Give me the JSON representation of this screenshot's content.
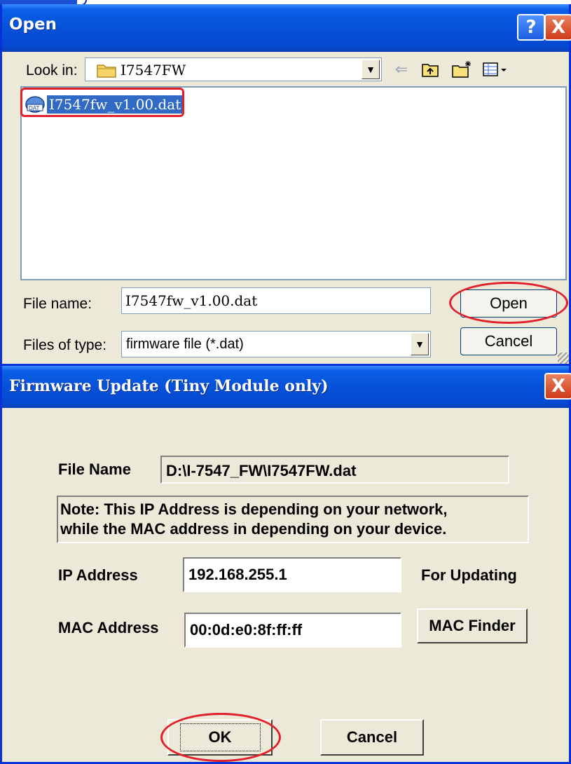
{
  "open_dialog": {
    "title": "Open",
    "help_button": "?",
    "close_button": "X",
    "look_in_label": "Look in:",
    "look_in_value": "I7547FW",
    "files": [
      {
        "name": "I7547fw_v1.00.dat",
        "icon": "dat-file-icon",
        "selected": true
      }
    ],
    "file_name_label": "File name:",
    "file_name_value": "I7547fw_v1.00.dat",
    "files_of_type_label": "Files of type:",
    "files_of_type_value": "firmware file (*.dat)",
    "open_button": "Open",
    "cancel_button": "Cancel",
    "toolbar_icons": [
      "back-arrow-icon",
      "up-folder-icon",
      "new-folder-icon",
      "view-menu-icon"
    ]
  },
  "firmware_dialog": {
    "title": "Firmware Update (Tiny Module only)",
    "close_button": "X",
    "file_name_label": "File Name",
    "file_name_value": "D:\\I-7547_FW\\I7547FW.dat",
    "note_line1": "Note: This IP Address is depending on your network,",
    "note_line2": "while the  MAC address in depending on your device.",
    "ip_label": "IP Address",
    "ip_value": "192.168.255.1",
    "ip_suffix": "For Updating",
    "mac_label": "MAC Address",
    "mac_value": "00:0d:e0:8f:ff:ff",
    "mac_finder_button": "MAC Finder",
    "ok_button": "OK",
    "cancel_button": "Cancel"
  },
  "colors": {
    "titlebar": "#0652d8",
    "dialog_bg": "#ece9d8",
    "highlight_annotation": "#e0202a",
    "selection": "#316ac5"
  }
}
